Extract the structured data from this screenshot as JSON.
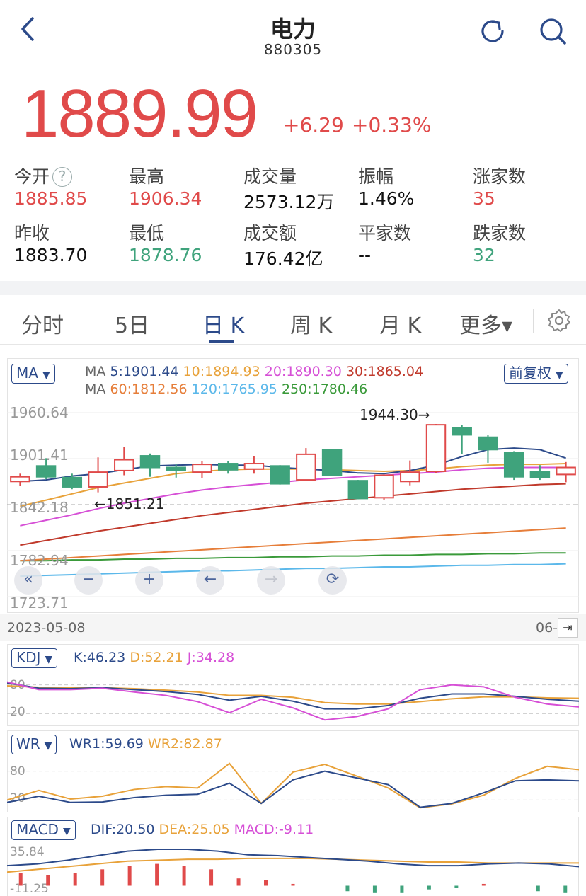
{
  "header": {
    "title": "电力",
    "code": "880305",
    "back_icon": "chevron-left-icon",
    "refresh_icon": "refresh-icon",
    "search_icon": "search-icon"
  },
  "quote": {
    "price": "1889.99",
    "change": "+6.29",
    "change_pct": "+0.33%",
    "up_color": "#e04a4a",
    "down_color": "#3fa37c"
  },
  "stats": {
    "open_label": "今开",
    "open_value": "1885.85",
    "high_label": "最高",
    "high_value": "1906.34",
    "volume_label": "成交量",
    "volume_value": "2573.12万",
    "amplitude_label": "振幅",
    "amplitude_value": "1.46%",
    "rise_count_label": "涨家数",
    "rise_count_value": "35",
    "prev_close_label": "昨收",
    "prev_close_value": "1883.70",
    "low_label": "最低",
    "low_value": "1878.76",
    "turnover_label": "成交额",
    "turnover_value": "176.42亿",
    "flat_count_label": "平家数",
    "flat_count_value": "--",
    "fall_count_label": "跌家数",
    "fall_count_value": "32",
    "help_icon": "question-circle-icon"
  },
  "tabs": [
    {
      "label": "分时"
    },
    {
      "label": "5日"
    },
    {
      "label": "日 K"
    },
    {
      "label": "周 K"
    },
    {
      "label": "月 K"
    },
    {
      "label": "更多▾"
    }
  ],
  "active_tab": "日 K",
  "settings_icon": "gear-icon",
  "kline": {
    "indicator_select": "MA",
    "adjust_select": "前复权",
    "ma_line1": {
      "prefix": "MA",
      "ma5": "5:1901.44",
      "ma10": "10:1894.93",
      "ma20": "20:1890.30",
      "ma30": "30:1865.04"
    },
    "ma_line2": {
      "prefix": "MA",
      "ma60": "60:1812.56",
      "ma120": "120:1765.95",
      "ma250": "250:1780.46"
    },
    "colors": {
      "ma5": "#2c4a8a",
      "ma10": "#e8a23a",
      "ma20": "#d64fd6",
      "ma30": "#c0392b",
      "ma60": "#e67e3a",
      "ma120": "#5bb8ea",
      "ma250": "#3a9a3a"
    },
    "y_ticks": [
      "1960.64",
      "1901.41",
      "1842.18",
      "1782.94",
      "1723.71"
    ],
    "high_mark": "1944.30→",
    "low_mark": "←1851.21",
    "start_date": "2023-05-08",
    "end_date": "06-",
    "controls": [
      "double-left-icon",
      "zoom-out-icon",
      "zoom-in-icon",
      "arrow-left-icon",
      "arrow-right-icon",
      "rotate-icon"
    ]
  },
  "kdj": {
    "select": "KDJ",
    "k": "K:46.23",
    "d": "D:52.21",
    "j": "J:34.28",
    "ticks": [
      "80",
      "20"
    ]
  },
  "wr": {
    "select": "WR",
    "wr1": "WR1:59.69",
    "wr2": "WR2:82.87",
    "ticks": [
      "80",
      "20"
    ]
  },
  "macd": {
    "select": "MACD",
    "dif": "DIF:20.50",
    "dea": "DEA:25.05",
    "macd": "MACD:-9.11",
    "ticks": [
      "35.84",
      "-11.25"
    ]
  },
  "chart_data": {
    "type": "line",
    "title": "",
    "candles": [
      {
        "o": 1872,
        "c": 1878,
        "h": 1882,
        "l": 1866
      },
      {
        "o": 1892,
        "c": 1878,
        "h": 1902,
        "l": 1875
      },
      {
        "o": 1877,
        "c": 1865,
        "h": 1882,
        "l": 1862
      },
      {
        "o": 1865,
        "c": 1884,
        "h": 1903,
        "l": 1858
      },
      {
        "o": 1886,
        "c": 1900,
        "h": 1916,
        "l": 1880
      },
      {
        "o": 1905,
        "c": 1890,
        "h": 1908,
        "l": 1878
      },
      {
        "o": 1890,
        "c": 1886,
        "h": 1894,
        "l": 1877
      },
      {
        "o": 1884,
        "c": 1894,
        "h": 1898,
        "l": 1876
      },
      {
        "o": 1895,
        "c": 1887,
        "h": 1898,
        "l": 1882
      },
      {
        "o": 1888,
        "c": 1895,
        "h": 1905,
        "l": 1882
      },
      {
        "o": 1892,
        "c": 1869,
        "h": 1893,
        "l": 1868
      },
      {
        "o": 1874,
        "c": 1907,
        "h": 1915,
        "l": 1873
      },
      {
        "o": 1913,
        "c": 1880,
        "h": 1913,
        "l": 1879
      },
      {
        "o": 1873,
        "c": 1850,
        "h": 1874,
        "l": 1849
      },
      {
        "o": 1851,
        "c": 1880,
        "h": 1881,
        "l": 1848
      },
      {
        "o": 1872,
        "c": 1884,
        "h": 1899,
        "l": 1867
      },
      {
        "o": 1885,
        "c": 1945,
        "h": 1946,
        "l": 1883
      },
      {
        "o": 1941,
        "c": 1932,
        "h": 1945,
        "l": 1907
      },
      {
        "o": 1929,
        "c": 1913,
        "h": 1932,
        "l": 1896
      },
      {
        "o": 1909,
        "c": 1878,
        "h": 1911,
        "l": 1874
      },
      {
        "o": 1885,
        "c": 1877,
        "h": 1893,
        "l": 1874
      },
      {
        "o": 1881,
        "c": 1890,
        "h": 1897,
        "l": 1871
      }
    ],
    "ma5": [
      1872,
      1874,
      1879,
      1882,
      1887,
      1892,
      1893,
      1894,
      1893,
      1893,
      1890,
      1888,
      1886,
      1883,
      1882,
      1886,
      1893,
      1904,
      1913,
      1915,
      1913,
      1902
    ],
    "ma10": [
      1840,
      1848,
      1856,
      1864,
      1870,
      1876,
      1882,
      1885,
      1887,
      1888,
      1888,
      1888,
      1887,
      1886,
      1885,
      1886,
      1888,
      1891,
      1893,
      1894,
      1894,
      1895
    ],
    "ma20": [
      1815,
      1822,
      1829,
      1837,
      1844,
      1850,
      1856,
      1861,
      1865,
      1868,
      1871,
      1874,
      1876,
      1878,
      1880,
      1882,
      1884,
      1887,
      1889,
      1890,
      1890,
      1890
    ],
    "ma30": [
      1790,
      1796,
      1802,
      1808,
      1813,
      1818,
      1823,
      1828,
      1832,
      1836,
      1840,
      1844,
      1847,
      1850,
      1853,
      1856,
      1859,
      1862,
      1864,
      1866,
      1868,
      1869
    ],
    "ma60": [
      1770,
      1772,
      1774,
      1776,
      1778,
      1780,
      1782,
      1784,
      1786,
      1788,
      1790,
      1792,
      1794,
      1796,
      1798,
      1800,
      1802,
      1804,
      1806,
      1808,
      1810,
      1812
    ],
    "ma120": [
      1750,
      1751,
      1752,
      1753,
      1754,
      1755,
      1756,
      1757,
      1757,
      1758,
      1759,
      1760,
      1760,
      1761,
      1762,
      1762,
      1763,
      1764,
      1764,
      1765,
      1765,
      1766
    ],
    "ma250": [
      1770,
      1770,
      1771,
      1771,
      1772,
      1772,
      1773,
      1773,
      1774,
      1774,
      1775,
      1775,
      1776,
      1776,
      1777,
      1777,
      1778,
      1778,
      1779,
      1779,
      1780,
      1780
    ],
    "ylim": [
      1723.71,
      1960.64
    ],
    "kdj_k": [
      84,
      73,
      72,
      74,
      70,
      66,
      60,
      48,
      56,
      46,
      30,
      30,
      37,
      52,
      61,
      61,
      56,
      50,
      46
    ],
    "kdj_d": [
      78,
      75,
      74,
      74,
      72,
      69,
      65,
      58,
      58,
      54,
      43,
      40,
      40,
      45,
      51,
      55,
      55,
      53,
      52
    ],
    "kdj_j": [
      86,
      70,
      70,
      73,
      65,
      58,
      45,
      22,
      50,
      32,
      7,
      14,
      30,
      70,
      80,
      76,
      54,
      40,
      34
    ],
    "wr1": [
      15,
      28,
      15,
      16,
      25,
      30,
      32,
      55,
      13,
      62,
      80,
      66,
      52,
      5,
      13,
      35,
      60,
      62,
      60
    ],
    "wr2": [
      20,
      40,
      22,
      28,
      42,
      48,
      45,
      96,
      13,
      78,
      94,
      70,
      45,
      4,
      12,
      30,
      65,
      90,
      83
    ],
    "macd_dif": [
      22,
      24,
      28,
      33,
      38,
      40,
      40,
      38,
      34,
      33,
      31,
      29,
      27,
      24,
      22,
      22,
      24,
      25,
      24,
      21
    ],
    "macd_dea": [
      15,
      18,
      21,
      24,
      27,
      28,
      29,
      29,
      30,
      30,
      30,
      29,
      28,
      27,
      26,
      26,
      25,
      25,
      25,
      25
    ],
    "macd_bar": [
      14,
      12,
      14,
      18,
      22,
      24,
      22,
      18,
      8,
      6,
      2,
      0,
      -6,
      -8,
      -8,
      -4,
      -2,
      2,
      0,
      -6,
      -8
    ]
  }
}
